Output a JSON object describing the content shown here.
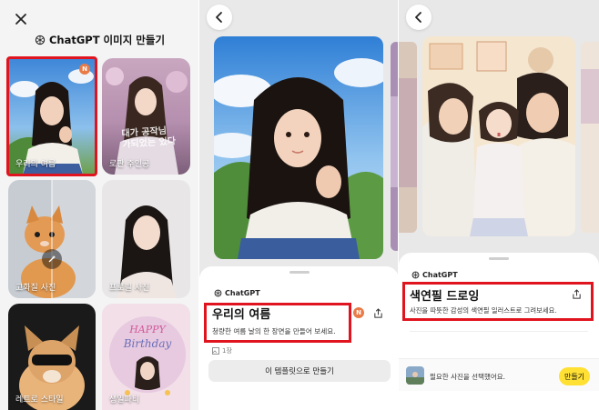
{
  "panel1": {
    "title": "ChatGPT 이미지 만들기",
    "tiles": [
      {
        "label": "우리의 여름",
        "badge": "N",
        "selected": true
      },
      {
        "label": "로판 주인공",
        "overlay_text": "대가 공작님 가되었는 있다"
      },
      {
        "label": "고화질 사진"
      },
      {
        "label": "프로필 사진"
      },
      {
        "label": "레트로 스타일"
      },
      {
        "label": "생일파티",
        "cake_text": "HAPPY Birthday"
      }
    ]
  },
  "panel2": {
    "brand": "ChatGPT",
    "title": "우리의 여름",
    "description": "청량한 여름 날의 한 장면을 만들어 보세요.",
    "badge": "N",
    "count": "1장",
    "button_label": "이 템플릿으로 만들기"
  },
  "panel3": {
    "brand": "ChatGPT",
    "title": "색연필 드로잉",
    "description": "사진을 따뜻한 감성의 색연필 일러스트로 그려보세요.",
    "footer_text": "필요한 사진을 선택했어요.",
    "footer_button": "만들기"
  },
  "colors": {
    "highlight_red": "#e0141e",
    "badge_orange": "#e87b47",
    "button_yellow": "#ffe033"
  },
  "icons": {
    "close": "close-icon",
    "back": "chevron-left-icon",
    "share": "share-icon",
    "logo": "openai-logo-icon"
  }
}
